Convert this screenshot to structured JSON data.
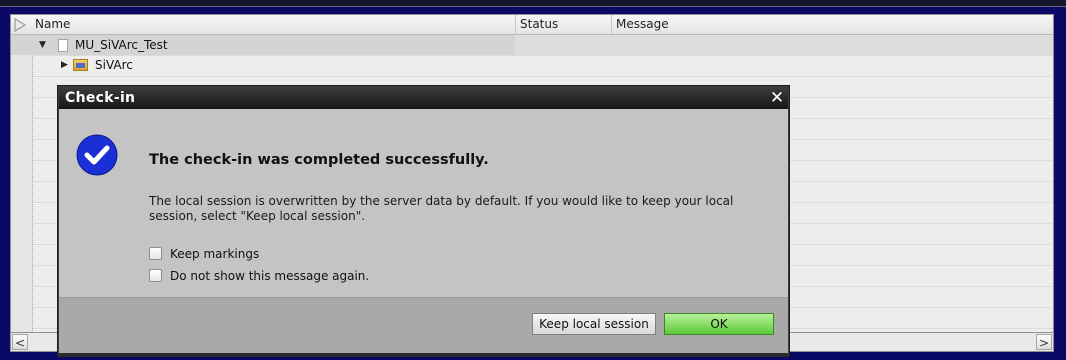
{
  "table": {
    "columns": [
      "Name",
      "Status",
      "Message"
    ],
    "rows": [
      {
        "name": "MU_SiVArc_Test",
        "level": 1,
        "icon": "document-icon",
        "expanded": true
      },
      {
        "name": "SiVArc",
        "level": 2,
        "icon": "folder-icon",
        "expanded": false
      }
    ]
  },
  "dialog": {
    "title": "Check-in",
    "close_glyph": "✕",
    "heading": "The check-in was completed successfully.",
    "message": "The local session is overwritten by the server data by default. If you would like to keep your local session, select \"Keep local session\".",
    "checkboxes": [
      {
        "label": "Keep markings",
        "checked": false
      },
      {
        "label": "Do not show this message again.",
        "checked": false
      }
    ],
    "buttons": {
      "keep_local": "Keep local session",
      "ok": "OK"
    },
    "icon": "success-check-icon"
  },
  "scrollbar": {
    "left_glyph": "<",
    "right_glyph": ">"
  },
  "colors": {
    "background": "#0a0a66",
    "dialog_title": "#1e1e1e",
    "ok_button": "#6fd14a",
    "check_icon": "#1a2fd6"
  }
}
